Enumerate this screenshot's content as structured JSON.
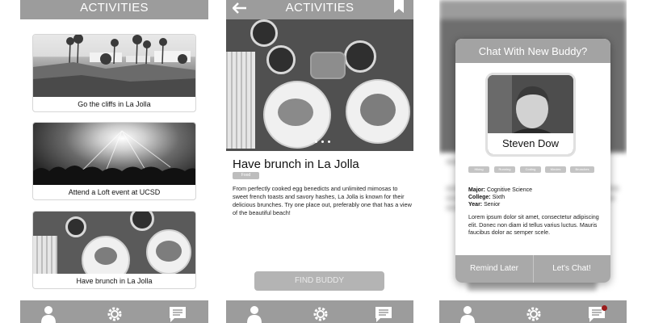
{
  "screen1": {
    "title": "ACTIVITIES",
    "cards": [
      {
        "caption": "Go the cliffs in La Jolla"
      },
      {
        "caption": "Attend a Loft event at UCSD"
      },
      {
        "caption": "Have brunch in La Jolla"
      }
    ]
  },
  "screen2": {
    "title": "ACTIVITIES",
    "activity_title": "Have brunch in La Jolla",
    "tag": "Food",
    "description": "From perfectly cooked egg benedicts and unlimited mimosas to sweet french toasts and savory hashes, La Jolla is known for their delicious brunches. Try one place out, preferably one that has a view of the beautiful beach!",
    "find_buddy_label": "FIND BUDDY"
  },
  "screen3": {
    "modal_title": "Chat With New Buddy?",
    "name": "Steven Dow",
    "interests": [
      "Hiking",
      "Running",
      "Coding",
      "Movies",
      "Brunches"
    ],
    "major_label": "Major:",
    "major": "Cognitive Science",
    "college_label": "College:",
    "college": "Sixth",
    "year_label": "Year:",
    "year": "Senior",
    "bio": "Lorem ipsum dolor sit amet, consectetur adipiscing elit. Donec non diam id tellus varius luctus. Mauris faucibus dolor ac semper scele.",
    "remind_label": "Remind Later",
    "chat_label": "Let's Chat!",
    "notification_color": "#9b1c1c"
  },
  "icons": {
    "profile": "person-icon",
    "activities": "gear-icon",
    "chat": "chat-bubble-icon",
    "back": "back-arrow-icon",
    "bookmark": "bookmark-icon"
  }
}
